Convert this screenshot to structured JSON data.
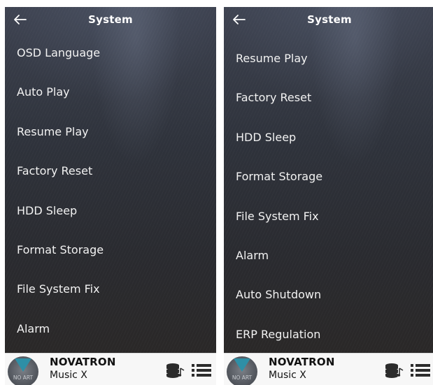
{
  "screens": [
    {
      "header": {
        "title": "System"
      },
      "menu": [
        "OSD Language",
        "Auto Play",
        "Resume Play",
        "Factory Reset",
        "HDD Sleep",
        "Format Storage",
        "File System Fix",
        "Alarm"
      ],
      "footer": {
        "device_name": "NOVATRON",
        "device_model": "Music X",
        "logo_text": "NO ART"
      }
    },
    {
      "header": {
        "title": "System"
      },
      "menu": [
        "Resume Play",
        "Factory Reset",
        "HDD Sleep",
        "Format Storage",
        "File System Fix",
        "Alarm",
        "Auto Shutdown",
        "ERP Regulation"
      ],
      "footer": {
        "device_name": "NOVATRON",
        "device_model": "Music X",
        "logo_text": "NO ART"
      }
    }
  ],
  "icons": {
    "back": "arrow-left-icon",
    "library": "music-library-icon",
    "queue": "list-icon"
  },
  "colors": {
    "background_dark": "#2f333c",
    "text_light": "#f2f2f2",
    "footer_bg": "#f7f7f7",
    "footer_text": "#111111",
    "logo_accent": "#2e8fa6"
  }
}
